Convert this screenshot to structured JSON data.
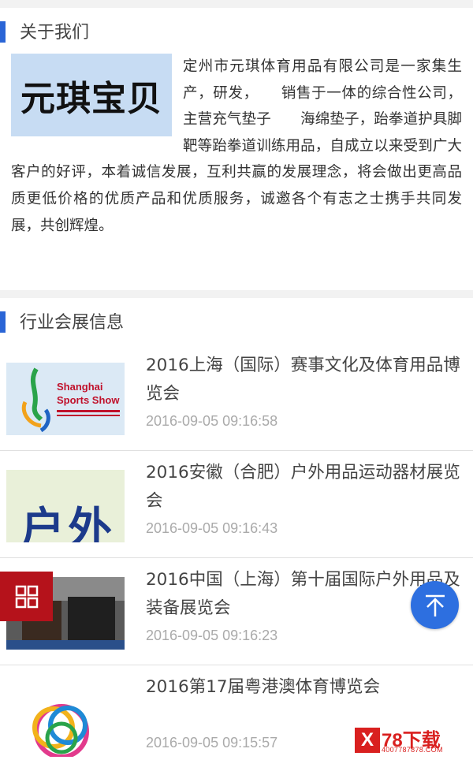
{
  "about": {
    "title": "关于我们",
    "logo_text": "元琪宝贝",
    "text": "定州市元琪体育用品有限公司是一家集生产，研发，　　销售于一体的综合性公司，主营充气垫子　　海绵垫子，跆拳道护具脚靶等跆拳道训练用品，自成立以来受到广大客户的好评，本着诚信发展，互利共赢的发展理念，将会做出更高品质更低价格的优质产品和优质服务，诚邀各个有志之士携手共同发展，共创辉煌。"
  },
  "news": {
    "title": "行业会展信息",
    "items": [
      {
        "title": "2016上海（国际）赛事文化及体育用品博览会",
        "date": "2016-09-05 09:16:58",
        "thumb_text": "Shanghai\nSports Show"
      },
      {
        "title": "2016安徽（合肥）户外用品运动器材展览会",
        "date": "2016-09-05 09:16:43",
        "thumb_text": "户外"
      },
      {
        "title": "2016中国（上海）第十届国际户外用品及装备展览会",
        "date": "2016-09-05 09:16:23",
        "thumb_text": ""
      },
      {
        "title": "2016第17届粤港澳体育博览会",
        "date": "2016-09-05 09:15:57",
        "thumb_text": ""
      }
    ]
  },
  "watermark": {
    "brand": "78下载",
    "url": "4007787878.COM"
  },
  "colors": {
    "accent": "#2a65d6",
    "menu_button": "#b5121b",
    "top_button": "#2d6fe0"
  }
}
